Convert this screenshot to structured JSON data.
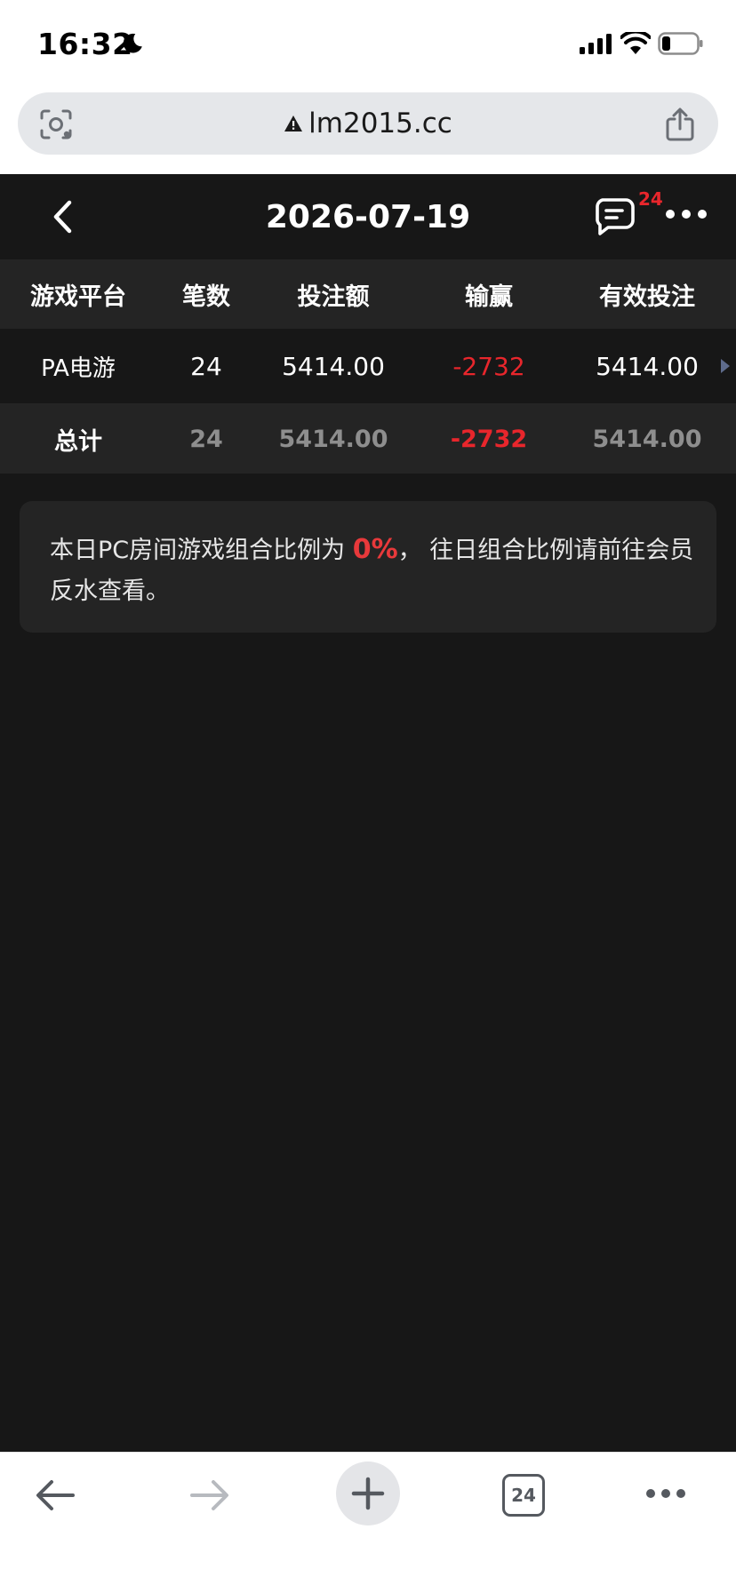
{
  "status_bar": {
    "time": "16:32"
  },
  "browser": {
    "url": "lm2015.cc"
  },
  "header": {
    "title": "2026-07-19",
    "chat_badge": "24"
  },
  "table": {
    "columns": [
      "游戏平台",
      "笔数",
      "投注额",
      "输赢",
      "有效投注"
    ],
    "rows": [
      {
        "platform": "PA电游",
        "count": "24",
        "bet": "5414.00",
        "winloss": "-2732",
        "valid_bet": "5414.00"
      }
    ],
    "total": {
      "label": "总计",
      "count": "24",
      "bet": "5414.00",
      "winloss": "-2732",
      "valid_bet": "5414.00"
    }
  },
  "notice": {
    "text_before": "本日PC房间游戏组合比例为 ",
    "percent": "0%",
    "text_after": "， 往日组合比例请前往会员反水查看。"
  },
  "toolbar": {
    "tab_count": "24"
  },
  "colors": {
    "accent_red": "#e8262c",
    "background": "#171717",
    "header_row": "#242424"
  }
}
